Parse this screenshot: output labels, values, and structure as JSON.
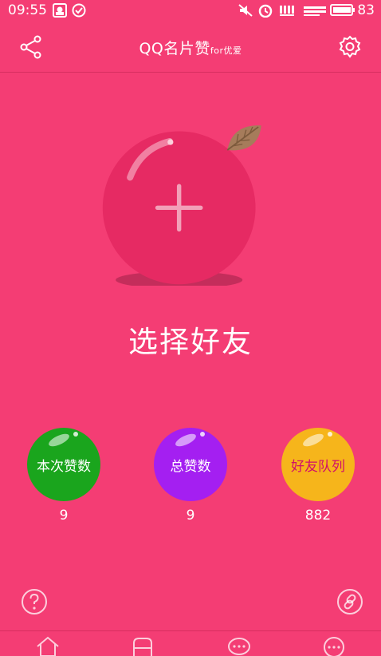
{
  "status_bar": {
    "time": "09:55",
    "battery": "83"
  },
  "app_bar": {
    "title": "QQ名片赞",
    "title_suffix": "for优爱"
  },
  "main": {
    "select_label": "选择好友"
  },
  "stats": [
    {
      "label": "本次赞数",
      "value": "9",
      "color": "#1aa51d"
    },
    {
      "label": "总赞数",
      "value": "9",
      "color": "#a41ff1"
    },
    {
      "label": "好友队列",
      "value": "882",
      "color": "#f6b51b",
      "label_color": "#d0106a"
    }
  ],
  "colors": {
    "background": "#f43d74",
    "circle": "#e62a63"
  },
  "icons": {
    "share": "share-icon",
    "settings": "gear-icon",
    "help": "help-icon",
    "link": "link-icon"
  }
}
